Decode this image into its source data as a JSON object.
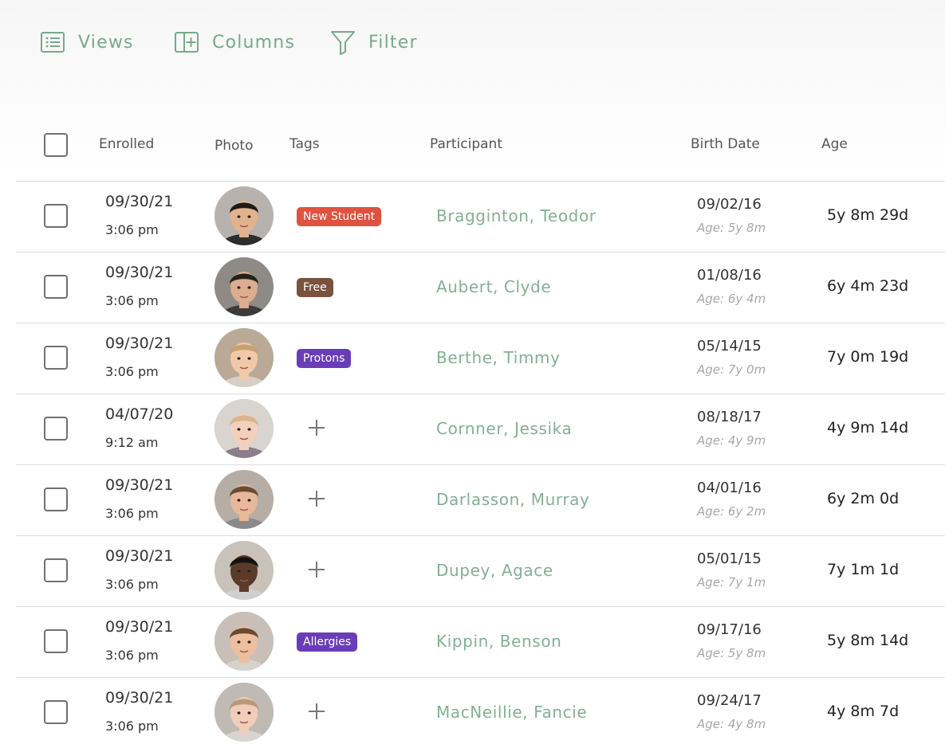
{
  "toolbar": {
    "views_label": "Views",
    "columns_label": "Columns",
    "filter_label": "Filter",
    "accent_color": "#78a98a"
  },
  "table": {
    "headers": {
      "enrolled": "Enrolled",
      "photo": "Photo",
      "tags": "Tags",
      "participant": "Participant",
      "birth_date": "Birth Date",
      "age": "Age"
    },
    "rows": [
      {
        "enrolled_date": "09/30/21",
        "enrolled_time": "3:06 pm",
        "photo": "child-photo",
        "tag": "New Student",
        "tag_color": "#e0523f",
        "participant": "Bragginton, Teodor",
        "birth_date": "09/02/16",
        "birth_age": "Age: 5y 8m",
        "age": "5y 8m 29d"
      },
      {
        "enrolled_date": "09/30/21",
        "enrolled_time": "3:06 pm",
        "photo": "child-photo",
        "tag": "Free",
        "tag_color": "#7a5240",
        "participant": "Aubert, Clyde",
        "birth_date": "01/08/16",
        "birth_age": "Age: 6y 4m",
        "age": "6y 4m 23d"
      },
      {
        "enrolled_date": "09/30/21",
        "enrolled_time": "3:06 pm",
        "photo": "child-photo",
        "tag": "Protons",
        "tag_color": "#6a3db8",
        "participant": "Berthe, Timmy",
        "birth_date": "05/14/15",
        "birth_age": "Age: 7y 0m",
        "age": "7y 0m 19d"
      },
      {
        "enrolled_date": "04/07/20",
        "enrolled_time": "9:12 am",
        "photo": "child-photo",
        "tag": "",
        "tag_color": "",
        "participant": "Cornner, Jessika",
        "birth_date": "08/18/17",
        "birth_age": "Age: 4y 9m",
        "age": "4y 9m 14d"
      },
      {
        "enrolled_date": "09/30/21",
        "enrolled_time": "3:06 pm",
        "photo": "child-photo",
        "tag": "",
        "tag_color": "",
        "participant": "Darlasson, Murray",
        "birth_date": "04/01/16",
        "birth_age": "Age: 6y 2m",
        "age": "6y 2m 0d"
      },
      {
        "enrolled_date": "09/30/21",
        "enrolled_time": "3:06 pm",
        "photo": "child-photo",
        "tag": "",
        "tag_color": "",
        "participant": "Dupey, Agace",
        "birth_date": "05/01/15",
        "birth_age": "Age: 7y 1m",
        "age": "7y 1m 1d"
      },
      {
        "enrolled_date": "09/30/21",
        "enrolled_time": "3:06 pm",
        "photo": "child-photo",
        "tag": "Allergies",
        "tag_color": "#6a3db8",
        "participant": "Kippin, Benson",
        "birth_date": "09/17/16",
        "birth_age": "Age: 5y 8m",
        "age": "5y 8m 14d"
      },
      {
        "enrolled_date": "09/30/21",
        "enrolled_time": "3:06 pm",
        "photo": "child-photo",
        "tag": "",
        "tag_color": "",
        "participant": "MacNeillie, Fancie",
        "birth_date": "09/24/17",
        "birth_age": "Age: 4y 8m",
        "age": "4y 8m 7d"
      }
    ]
  }
}
